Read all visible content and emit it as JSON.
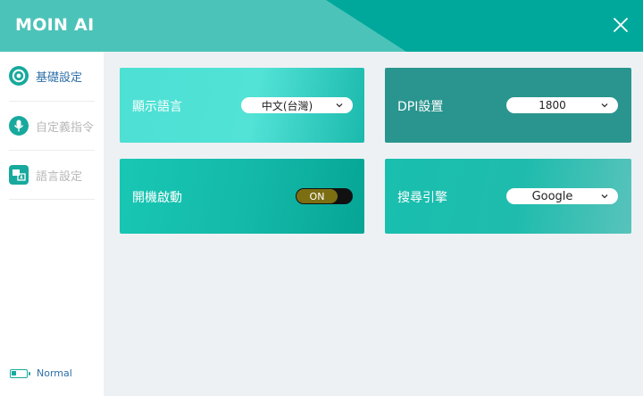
{
  "app": {
    "title": "MOIN AI"
  },
  "sidebar": {
    "items": [
      {
        "label": "基礎設定",
        "icon": "settings-icon",
        "active": true
      },
      {
        "label": "自定義指令",
        "icon": "microphone-icon",
        "active": false
      },
      {
        "label": "語言設定",
        "icon": "language-icon",
        "active": false
      }
    ],
    "status": {
      "label": "Normal",
      "icon": "battery-icon"
    }
  },
  "cards": {
    "display_language": {
      "title": "顯示語言",
      "value": "中文(台灣)"
    },
    "dpi": {
      "title": "DPI設置",
      "value": "1800"
    },
    "startup": {
      "title": "開機啟動",
      "value": "ON"
    },
    "search_engine": {
      "title": "搜尋引擎",
      "value": "Google"
    }
  },
  "colors": {
    "header": "#00a89c",
    "header_band": "#4cc3b9",
    "accent": "#17a99d",
    "active_text": "#2e6fa8",
    "inactive_text": "#b8b8b8",
    "toggle_on": "#7c6e12"
  }
}
